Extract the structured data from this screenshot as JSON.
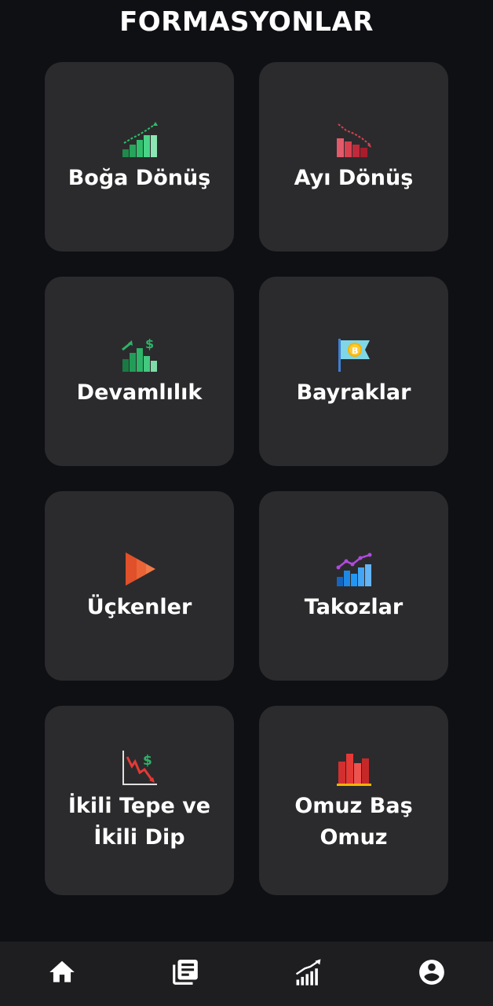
{
  "header": {
    "title": "FORMASYONLAR"
  },
  "cards": [
    {
      "label": "Boğa Dönüş",
      "icon": "bull-chart-up-icon"
    },
    {
      "label": "Ayı Dönüş",
      "icon": "bear-chart-down-icon"
    },
    {
      "label": "Devamlılık",
      "icon": "continuation-chart-icon"
    },
    {
      "label": "Bayraklar",
      "icon": "bitcoin-flag-icon"
    },
    {
      "label": "Üçkenler",
      "icon": "triangle-play-icon"
    },
    {
      "label": "Takozlar",
      "icon": "wedge-chart-icon"
    },
    {
      "label": "İkili Tepe ve İkili Dip",
      "icon": "double-top-chart-icon"
    },
    {
      "label": "Omuz Baş Omuz",
      "icon": "head-shoulders-bars-icon"
    }
  ],
  "bottom_nav": {
    "items": [
      {
        "icon": "home-icon"
      },
      {
        "icon": "documents-icon"
      },
      {
        "icon": "signal-chart-icon"
      },
      {
        "icon": "account-icon"
      }
    ]
  },
  "colors": {
    "background": "#0f1014",
    "card": "#2b2b2d",
    "nav": "#1e1e20",
    "text": "#ffffff"
  }
}
